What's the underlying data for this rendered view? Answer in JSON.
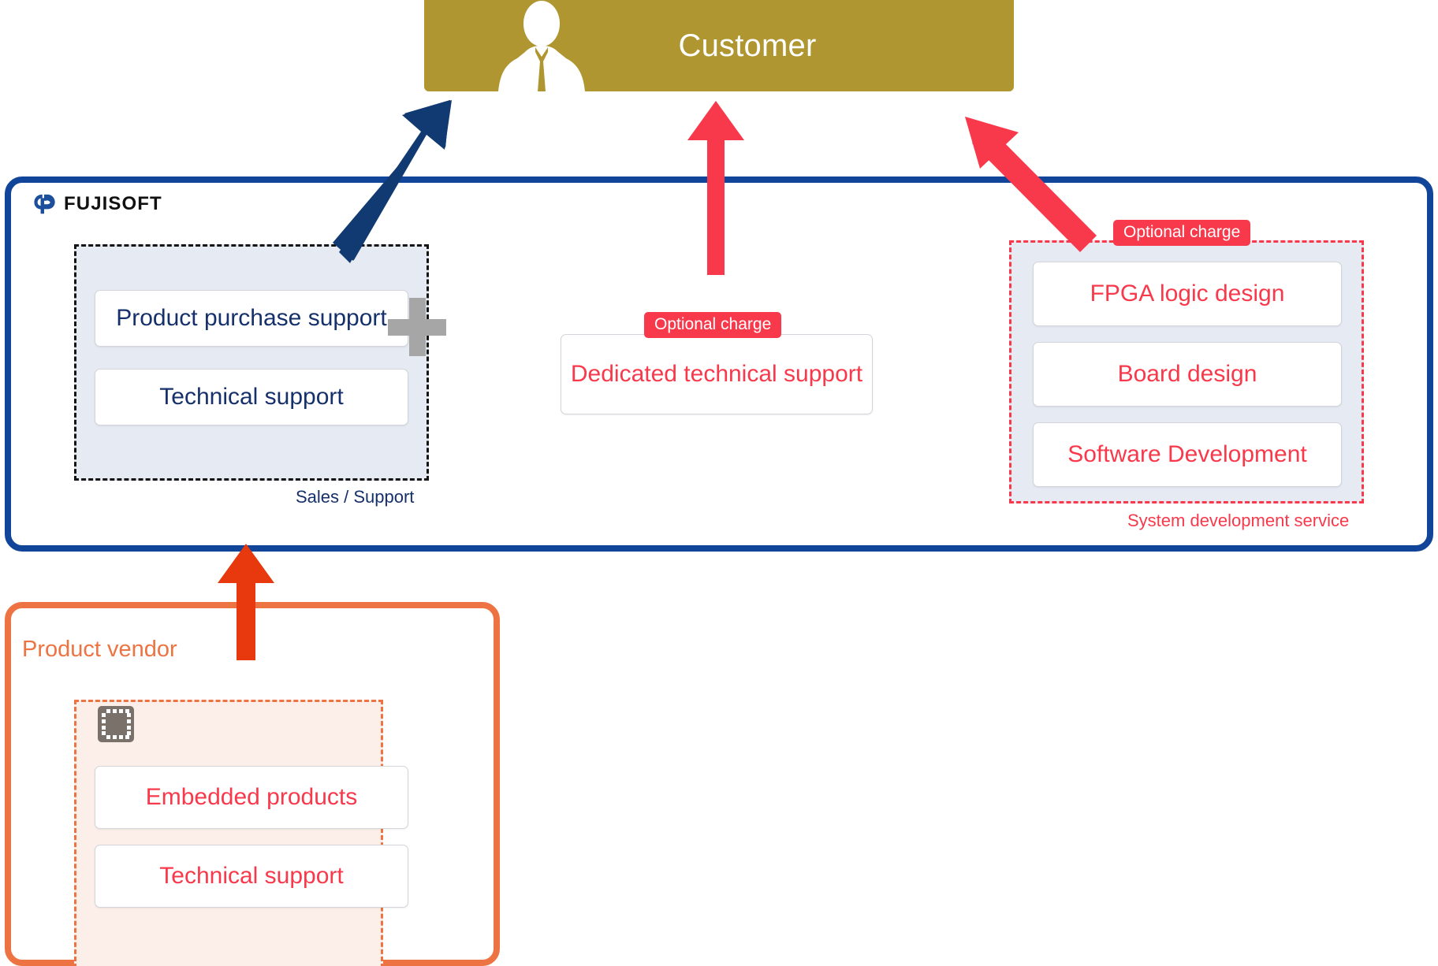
{
  "customer": {
    "label": "Customer",
    "icon": "person-silhouette-icon",
    "bg_color": "#AF9631"
  },
  "fujisoft": {
    "logo_text": "FUJISOFT",
    "logo_mark": "fujisoft-logo-mark-icon",
    "border_color": "#11459A",
    "sales_support": {
      "caption": "Sales / Support",
      "items": [
        {
          "label": "Product purchase support"
        },
        {
          "label": "Technical support"
        }
      ]
    },
    "plus": {
      "icon": "plus-icon",
      "color": "#A6A6A6"
    },
    "dedicated": {
      "badge": "Optional charge",
      "label": "Dedicated technical support"
    },
    "system_development": {
      "badge": "Optional charge",
      "caption": "System development service",
      "items": [
        {
          "label": "FPGA logic design"
        },
        {
          "label": "Board design"
        },
        {
          "label": "Software Development"
        }
      ]
    }
  },
  "vendor": {
    "title": "Product vendor",
    "border_color": "#ED7442",
    "chip_icon": "microchip-icon",
    "items": [
      {
        "label": "Embedded products"
      },
      {
        "label": "Technical support"
      }
    ]
  },
  "arrows": [
    {
      "name": "sales-support-to-customer-arrow",
      "color": "#123A72",
      "direction": "up-right"
    },
    {
      "name": "dedicated-support-to-customer-arrow",
      "color": "#F8394B",
      "direction": "up"
    },
    {
      "name": "system-development-to-customer-arrow",
      "color": "#F8394B",
      "direction": "up-left"
    },
    {
      "name": "vendor-to-fujisoft-arrow",
      "color": "#E8380D",
      "direction": "up"
    }
  ],
  "colors": {
    "accent_blue": "#11459A",
    "accent_red": "#F8394B",
    "accent_orange": "#ED7442",
    "customer_gold": "#AF9631",
    "group_fill": "#E6EAF3",
    "vendor_fill": "#FCEFEA"
  }
}
